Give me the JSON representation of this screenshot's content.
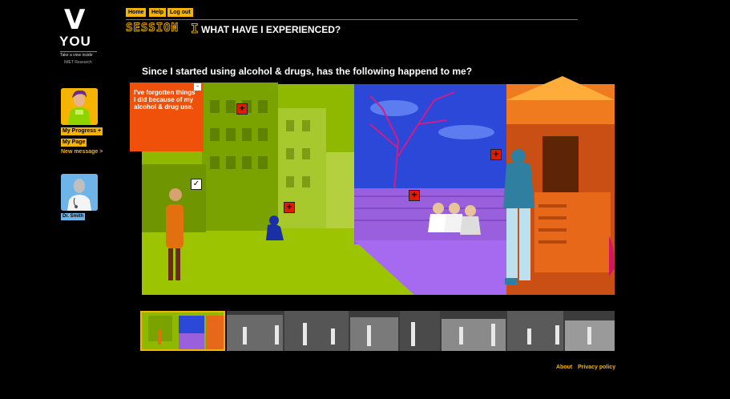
{
  "brand": {
    "mark": "V",
    "name": "YOU",
    "tagline": "Take a view inside",
    "org": "IMET Research"
  },
  "nav": {
    "home": "Home",
    "help": "Help",
    "logout": "Log out"
  },
  "header": {
    "session_word": "SESSION",
    "session_number": "I",
    "title": "WHAT HAVE I EXPERIENCED?"
  },
  "sidebar": {
    "my_progress": "My Progress",
    "my_progress_icon": "+",
    "my_page": "My Page",
    "new_message": "New message >",
    "doctor_name": "Dr. Smith"
  },
  "main": {
    "question": "Since I started using alcohol & drugs, has the following happend to me?",
    "popup_text": "I've forgotten things I did because of my alcohol & drug use.",
    "popup_close": "-",
    "plus_glyph": "+",
    "check_glyph": "✓"
  },
  "footer": {
    "about": "About",
    "privacy": "Privacy policy"
  },
  "colors": {
    "accent": "#f5b400",
    "popup": "#f0510a",
    "marker": "#e21b00",
    "green": "#9cc400",
    "purple": "#9a5fdc",
    "sky": "#2b48d8"
  }
}
